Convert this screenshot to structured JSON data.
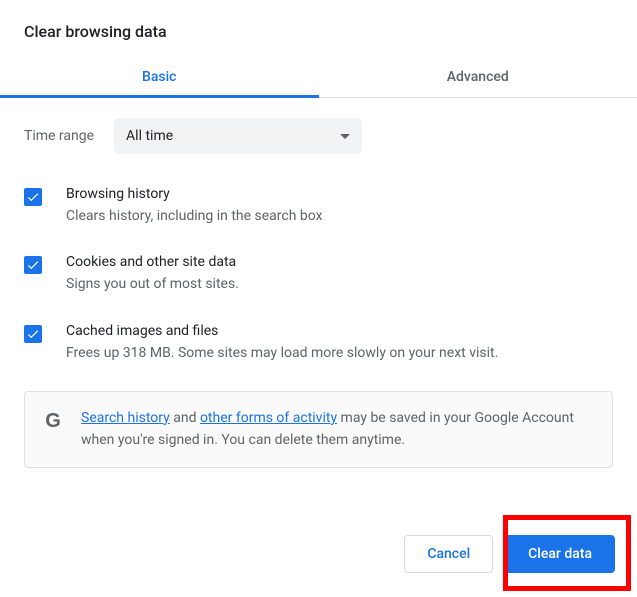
{
  "title": "Clear browsing data",
  "tabs": {
    "basic": "Basic",
    "advanced": "Advanced"
  },
  "time": {
    "label": "Time range",
    "value": "All time"
  },
  "options": [
    {
      "title": "Browsing history",
      "desc": "Clears history, including in the search box"
    },
    {
      "title": "Cookies and other site data",
      "desc": "Signs you out of most sites."
    },
    {
      "title": "Cached images and files",
      "desc": "Frees up 318 MB. Some sites may load more slowly on your next visit."
    }
  ],
  "info": {
    "link1": "Search history",
    "mid1": " and ",
    "link2": "other forms of activity",
    "rest": " may be saved in your Google Account when you're signed in. You can delete them anytime."
  },
  "buttons": {
    "cancel": "Cancel",
    "clear": "Clear data"
  }
}
